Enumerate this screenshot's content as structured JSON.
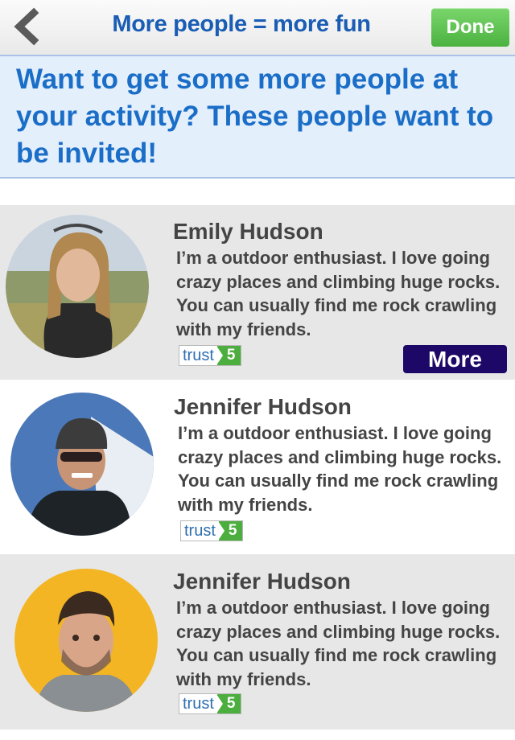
{
  "nav": {
    "back_icon": "chevron-left-icon",
    "title": "More people = more fun",
    "done_label": "Done"
  },
  "banner": {
    "text": "Want to get some more people at your activity? These people want to be invited!"
  },
  "people": [
    {
      "name": "Emily Hudson",
      "bio": "I’m a outdoor enthusiast. I love going crazy places and climbing huge rocks. You can usually find me rock crawling with my friends.",
      "trust_label": "trust",
      "trust_score": "5",
      "more_label": "More"
    },
    {
      "name": "Jennifer Hudson",
      "bio": "I’m a outdoor enthusiast. I love going crazy places and climbing huge rocks. You can usually find me rock crawling with my friends.",
      "trust_label": "trust",
      "trust_score": "5"
    },
    {
      "name": "Jennifer Hudson",
      "bio": "I’m a outdoor enthusiast. I love going crazy places and climbing huge rocks. You can usually find me rock crawling with my friends.",
      "trust_label": "trust",
      "trust_score": "5"
    }
  ],
  "colors": {
    "nav_title": "#1a5db4",
    "done_green": "#4bb240",
    "banner_bg": "#e4effc",
    "banner_text": "#1b6ec7",
    "row_gray": "#e7e7e7",
    "more_button": "#1d0868",
    "trust_green": "#4cae3e"
  }
}
